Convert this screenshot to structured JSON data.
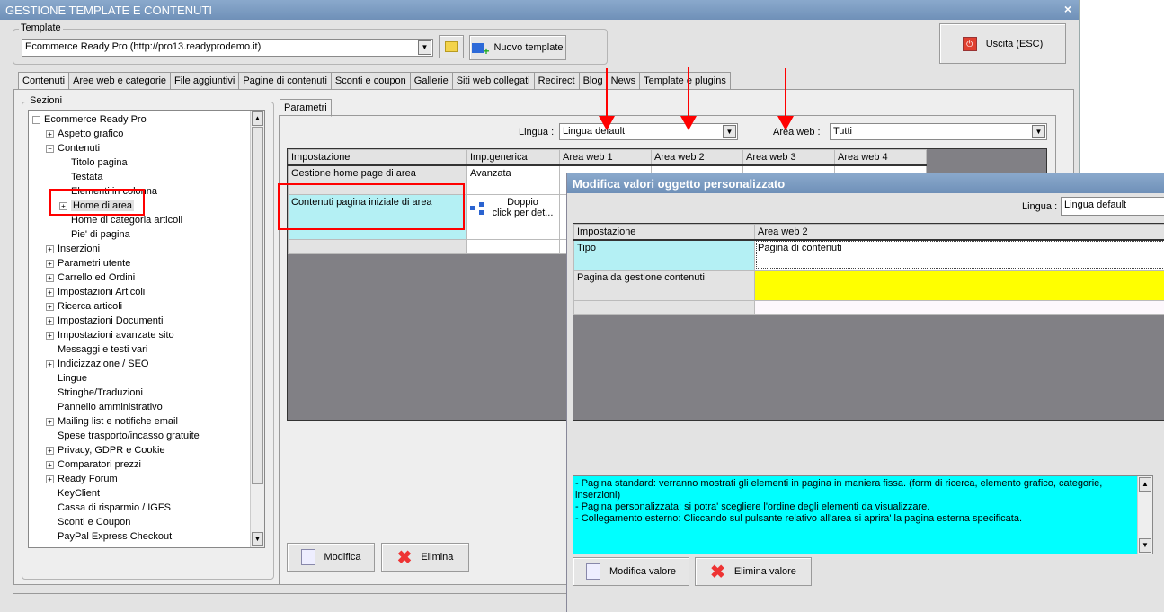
{
  "window": {
    "title": "GESTIONE TEMPLATE E CONTENUTI",
    "close": "×"
  },
  "template": {
    "label": "Template",
    "selected": "Ecommerce Ready Pro (http://pro13.readyprodemo.it)",
    "new_button": "Nuovo template",
    "exit_button": "Uscita (ESC)"
  },
  "tabs": [
    "Contenuti",
    "Aree web e categorie",
    "File aggiuntivi",
    "Pagine di contenuti",
    "Sconti e coupon",
    "Gallerie",
    "Siti web collegati",
    "Redirect",
    "Blog",
    "News",
    "Template e plugins"
  ],
  "sections": {
    "label": "Sezioni",
    "items": [
      {
        "label": "Ecommerce Ready Pro",
        "exp": "−",
        "level": 0
      },
      {
        "label": "Aspetto grafico",
        "exp": "+",
        "level": 1
      },
      {
        "label": "Contenuti",
        "exp": "−",
        "level": 1
      },
      {
        "label": "Titolo pagina",
        "exp": "",
        "level": 2
      },
      {
        "label": "Testata",
        "exp": "",
        "level": 2
      },
      {
        "label": "Elementi in colonna",
        "exp": "",
        "level": 2
      },
      {
        "label": "Home di area",
        "exp": "+",
        "level": 2,
        "selected": true
      },
      {
        "label": "Home di categoria articoli",
        "exp": "",
        "level": 2
      },
      {
        "label": "Pie' di pagina",
        "exp": "",
        "level": 2
      },
      {
        "label": "Inserzioni",
        "exp": "+",
        "level": 1
      },
      {
        "label": "Parametri utente",
        "exp": "+",
        "level": 1
      },
      {
        "label": "Carrello ed Ordini",
        "exp": "+",
        "level": 1
      },
      {
        "label": "Impostazioni Articoli",
        "exp": "+",
        "level": 1
      },
      {
        "label": "Ricerca articoli",
        "exp": "+",
        "level": 1
      },
      {
        "label": "Impostazioni Documenti",
        "exp": "+",
        "level": 1
      },
      {
        "label": "Impostazioni avanzate sito",
        "exp": "+",
        "level": 1
      },
      {
        "label": "Messaggi e testi vari",
        "exp": "",
        "level": 1
      },
      {
        "label": "Indicizzazione / SEO",
        "exp": "+",
        "level": 1
      },
      {
        "label": "Lingue",
        "exp": "",
        "level": 1
      },
      {
        "label": "Stringhe/Traduzioni",
        "exp": "",
        "level": 1
      },
      {
        "label": "Pannello amministrativo",
        "exp": "",
        "level": 1
      },
      {
        "label": "Mailing list e notifiche email",
        "exp": "+",
        "level": 1
      },
      {
        "label": "Spese trasporto/incasso gratuite",
        "exp": "",
        "level": 1
      },
      {
        "label": "Privacy, GDPR e Cookie",
        "exp": "+",
        "level": 1
      },
      {
        "label": "Comparatori prezzi",
        "exp": "+",
        "level": 1
      },
      {
        "label": "Ready Forum",
        "exp": "+",
        "level": 1
      },
      {
        "label": "KeyClient",
        "exp": "",
        "level": 1
      },
      {
        "label": "Cassa di risparmio / IGFS",
        "exp": "",
        "level": 1
      },
      {
        "label": "Sconti e Coupon",
        "exp": "",
        "level": 1
      },
      {
        "label": "PayPal Express Checkout",
        "exp": "",
        "level": 1
      }
    ]
  },
  "params": {
    "tab": "Parametri",
    "lingua_label": "Lingua :",
    "lingua_value": "Lingua default",
    "area_label": "Area web :",
    "area_value": "Tutti",
    "columns": [
      "Impostazione",
      "Imp.generica",
      "Area web 1",
      "Area web 2",
      "Area web 3",
      "Area web 4"
    ],
    "rows": [
      {
        "name": "Gestione home page di area",
        "generic": "Avanzata"
      },
      {
        "name": "Contenuti pagina iniziale di area",
        "generic_l1": "Doppio",
        "generic_l2": "click per det..."
      }
    ],
    "modify": "Modifica",
    "delete": "Elimina"
  },
  "dialog": {
    "title": "Modifica valori oggetto personalizzato",
    "lingua_label": "Lingua :",
    "lingua_value": "Lingua default",
    "columns": [
      "Impostazione",
      "Area web 2"
    ],
    "rows": [
      {
        "name": "Tipo",
        "value": "Pagina di contenuti"
      },
      {
        "name": "Pagina da gestione contenuti",
        "value": ""
      }
    ],
    "description": [
      "- Pagina standard: verranno mostrati gli elementi in pagina in maniera fissa. (form di ricerca, elemento grafico, categorie, inserzioni)",
      "- Pagina personalizzata: si potra' scegliere l'ordine degli elementi da visualizzare.",
      "- Collegamento esterno: Cliccando sul pulsante relativo all'area si aprira' la pagina esterna specificata."
    ],
    "modify": "Modifica valore",
    "delete": "Elimina valore"
  },
  "colors": {
    "highlight": "#b4f0f4",
    "yellow": "#ffff00",
    "desc_bg": "#00ffff",
    "annotation": "#ff0000"
  }
}
